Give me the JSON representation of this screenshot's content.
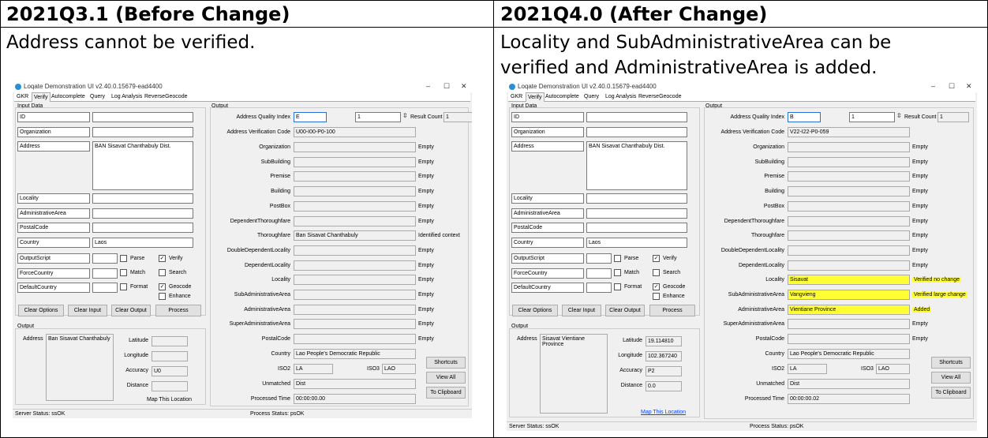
{
  "panels": [
    {
      "title": "2021Q3.1 (Before Change)",
      "description": [
        "Address cannot be verified."
      ]
    },
    {
      "title": "2021Q4.0 (After Change)",
      "description": [
        "Locality and SubAdministrativeArea can be",
        "verified and AdministrativeArea is added."
      ]
    }
  ],
  "app": {
    "window_title": "Loqate Demonstration UI v2.40.0.15679-ead4400",
    "window_buttons": [
      "–",
      "☐",
      "✕"
    ],
    "tabs": [
      "GKR",
      "Verify",
      "Autocomplete",
      "Query",
      "Log Analysis",
      "ReverseGeocode"
    ],
    "input_data_title": "Input Data",
    "input_rows": [
      {
        "field": "ID",
        "value": ""
      },
      {
        "field": "Organization",
        "value": ""
      },
      {
        "field": "Address",
        "value": "BAN Sisavat Chanthabuly Dist."
      },
      {
        "field": "Locality",
        "value": ""
      },
      {
        "field": "AdministrativeArea",
        "value": ""
      },
      {
        "field": "PostalCode",
        "value": ""
      },
      {
        "field": "Country",
        "value": "Laos"
      }
    ],
    "option_rows": [
      "OutputScript",
      "ForceCountry",
      "DefaultCountry"
    ],
    "checkboxes": {
      "parse": "Parse",
      "verify": "Verify",
      "match": "Match",
      "search": "Search",
      "format": "Format",
      "geocode": "Geocode",
      "enhance": "Enhance",
      "checked_mark": "✓"
    },
    "buttons": {
      "clear_options": "Clear Options",
      "clear_input": "Clear Input",
      "clear_output": "Clear Output",
      "process": "Process",
      "shortcuts": "Shortcuts",
      "view_all": "View All",
      "to_clipboard": "To Clipboard"
    },
    "output_title": "Output",
    "output_address_label": "Address",
    "geo_labels": [
      "Latitude",
      "Longitude",
      "Accuracy",
      "Distance"
    ],
    "map_link": "Map This Location",
    "aqi_label": "Address Quality Index",
    "result_count_label": "Result Count",
    "avc_label": "Address Verification Code",
    "fields": [
      "Organization",
      "SubBuilding",
      "Premise",
      "Building",
      "PostBox",
      "DependentThoroughfare",
      "Thoroughfare",
      "DoubleDependentLocality",
      "DependentLocality",
      "Locality",
      "SubAdministrativeArea",
      "AdministrativeArea",
      "SuperAdministrativeArea",
      "PostalCode"
    ],
    "country_label": "Country",
    "iso2_label": "ISO2",
    "iso3_label": "ISO3",
    "unmatched_label": "Unmatched",
    "processed_time_label": "Processed Time",
    "server_status": "Server Status: ssOK",
    "process_status": "Process Status: psOK"
  },
  "before": {
    "aqi": "E",
    "aqi_spin": "1",
    "result_count": "1",
    "avc": "U00-I00-P0-100",
    "field_values": [
      "",
      "",
      "",
      "",
      "",
      "",
      "Ban Sisavat Chanthabuly",
      "",
      "",
      "",
      "",
      "",
      "",
      ""
    ],
    "field_status": [
      "Empty",
      "Empty",
      "Empty",
      "Empty",
      "Empty",
      "Empty",
      "Identified context",
      "Empty",
      "Empty",
      "Empty",
      "Empty",
      "Empty",
      "Empty",
      "Empty"
    ],
    "country": "Lao People's Democratic Republic",
    "iso2": "LA",
    "iso3": "LAO",
    "unmatched": "Dist",
    "processed_time": "00:00:00.00",
    "out_address": "Ban Sisavat Chanthabuly",
    "geo_values": [
      "",
      "",
      "U0",
      ""
    ]
  },
  "after": {
    "aqi": "B",
    "aqi_spin": "1",
    "result_count": "1",
    "avc": "V22-I22-P0-059",
    "field_values": [
      "",
      "",
      "",
      "",
      "",
      "",
      "",
      "",
      "",
      "Sisavat",
      "Vangvieng",
      "Vientiane Province",
      "",
      ""
    ],
    "field_status": [
      "Empty",
      "Empty",
      "Empty",
      "Empty",
      "Empty",
      "Empty",
      "Empty",
      "Empty",
      "Empty",
      "Verified no change",
      "Verified large change",
      "Added",
      "Empty",
      "Empty"
    ],
    "country": "Lao People's Democratic Republic",
    "iso2": "LA",
    "iso3": "LAO",
    "unmatched": "Dist",
    "processed_time": "00:00:00.02",
    "out_address": "Sisavat Vientiane Province",
    "geo_values": [
      "19.114810",
      "102.367240",
      "P2",
      "0.0"
    ]
  },
  "colors": {
    "highlight": "#ffff33",
    "link": "#0645ff"
  }
}
